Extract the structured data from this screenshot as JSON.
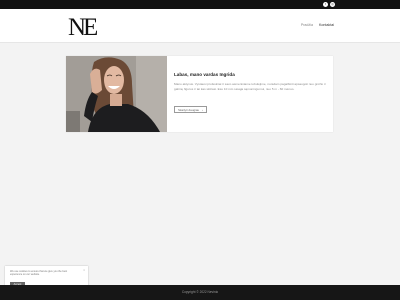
{
  "social": {
    "facebook_glyph": "f",
    "instagram_glyph": "◎"
  },
  "brand": {
    "logo_text": "NE"
  },
  "nav": {
    "items": [
      {
        "label": "Pradžia"
      },
      {
        "label": "Kontaktai"
      }
    ]
  },
  "hero": {
    "title": "Labas, mano vardas Ingrida",
    "description": "Mano aktyvus. Vystausi profesiniai ir savo asmeniniame tobulėjime, norėdam pagalbinti apsaugoti nuo grožio ir galimų figuros ir tai kas skiriasi. Esu 10 mm savąja sąmoningumui, nuo 5 m - 60 mėnuo.",
    "button_label": "Skaityti daugiau",
    "button_icon": "chevron-right-icon"
  },
  "cookie": {
    "text": "We use cookies to ensure that we give you the best experience on our website.",
    "accept_label": "Accept",
    "close_glyph": "×"
  },
  "footer": {
    "copyright": "Copyright © 2022 Nevinio"
  },
  "colors": {
    "topbar": "#121212",
    "footer": "#161616",
    "background": "#f3f3f3",
    "card": "#ffffff"
  }
}
